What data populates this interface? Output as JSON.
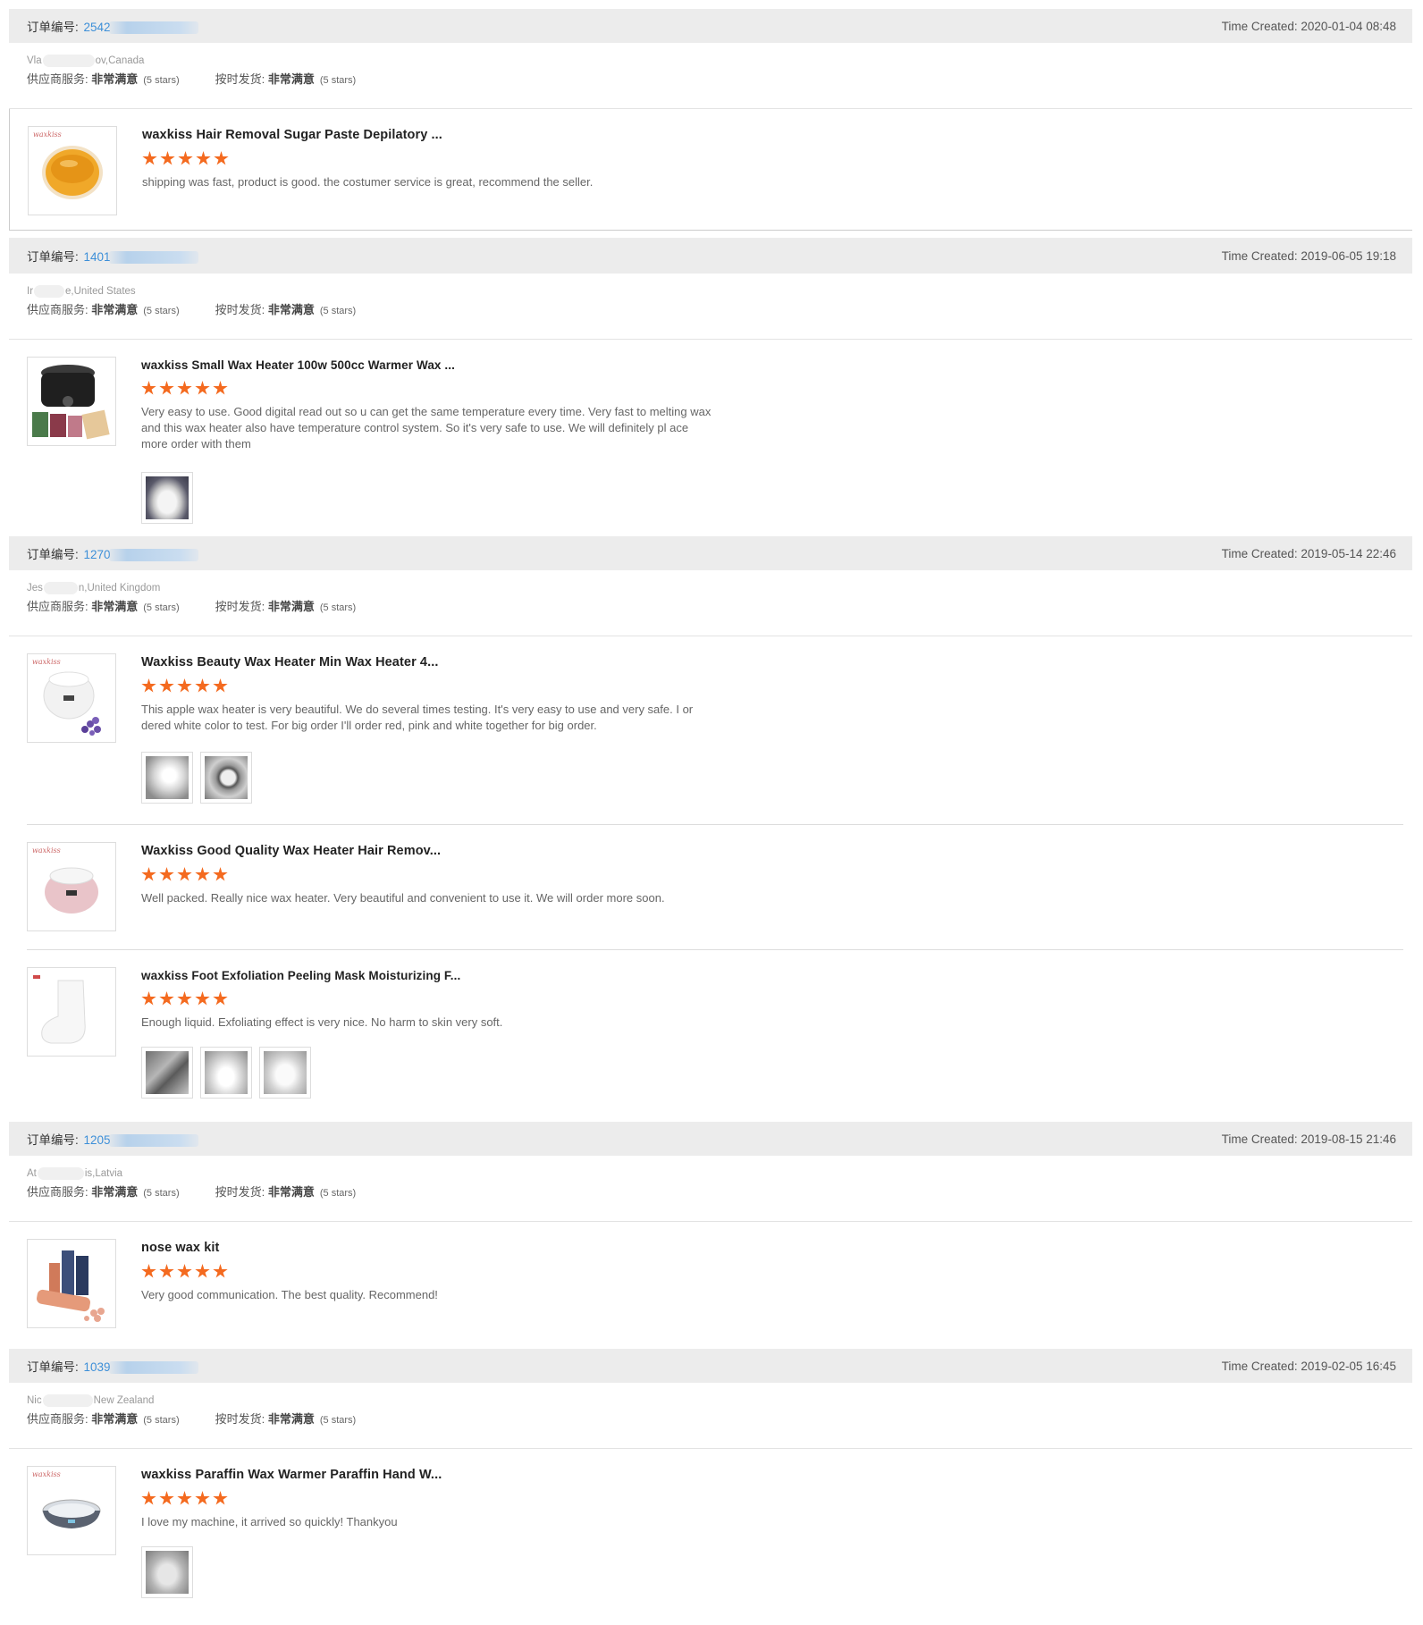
{
  "labels": {
    "order_no": "订单编号:",
    "time_created": "Time Created:",
    "supplier_service": "供应商服务:",
    "on_time_shipping": "按时发货:",
    "very_satisfied": "非常满意",
    "five_stars": "(5 stars)"
  },
  "orders": [
    {
      "order_no": "2542",
      "time": "2020-01-04 08:48",
      "buyer": {
        "start": "Vla",
        "end": "ov,Canada"
      },
      "products": [
        {
          "title": "waxkiss Hair Removal Sugar Paste Depilatory ...",
          "review": "shipping was fast, product is good. the costumer service is great, recommend the seller.",
          "thumb_icon": "sugar-paste-jar-icon",
          "photos": []
        }
      ]
    },
    {
      "order_no": "1401",
      "time": "2019-06-05 19:18",
      "buyer": {
        "start": "Ir",
        "end": "e,United States"
      },
      "products": [
        {
          "title": "waxkiss Small Wax Heater 100w 500cc Warmer Wax ...",
          "review": "Very easy to use. Good digital read out so u can get the same temperature every time. Very fast to melting wax and this wax heater also have temperature control system. So it's very safe to use. We will definitely pl ace more order with them",
          "thumb_icon": "black-wax-heater-icon",
          "photos": [
            "wax-heater-photo-icon"
          ]
        }
      ]
    },
    {
      "order_no": "1270",
      "time": "2019-05-14 22:46",
      "buyer": {
        "start": "Jes",
        "end": "n,United Kingdom"
      },
      "products": [
        {
          "title": "Waxkiss Beauty Wax Heater Min Wax Heater 4...",
          "review": "This apple wax heater is very beautiful.  We do several times testing. It's very easy to use and very safe. I or dered white color to test. For big order I'll order red, pink and white together for big order.",
          "thumb_icon": "white-wax-heater-icon",
          "photos": [
            "heater-side-photo-icon",
            "heater-top-photo-icon"
          ]
        },
        {
          "title": "Waxkiss Good Quality Wax Heater Hair Remov...",
          "review": "Well packed. Really nice wax heater. Very beautiful and convenient to use it. We will order more soon.",
          "thumb_icon": "pink-wax-heater-icon",
          "photos": []
        },
        {
          "title": "waxkiss Foot Exfoliation Peeling Mask Moisturizing F...",
          "review": "Enough liquid. Exfoliating effect is very nice. No harm to skin very soft.",
          "thumb_icon": "foot-mask-icon",
          "photos": [
            "mask-package-photo-icon",
            "mask-sock-photo-icon",
            "mask-pair-photo-icon"
          ]
        }
      ]
    },
    {
      "order_no": "1205",
      "time": "2019-08-15 21:46",
      "buyer": {
        "start": "At",
        "end": "is,Latvia"
      },
      "products": [
        {
          "title": "nose wax kit",
          "review": "Very good communication. The best quality. Recommend!",
          "thumb_icon": "nose-wax-kit-icon",
          "photos": []
        }
      ]
    },
    {
      "order_no": "1039",
      "time": "2019-02-05 16:45",
      "buyer": {
        "start": "Nic",
        "end": "New Zealand"
      },
      "products": [
        {
          "title": "waxkiss Paraffin Wax Warmer Paraffin Hand W...",
          "review": "I love my machine, it arrived so quickly! Thankyou",
          "thumb_icon": "paraffin-warmer-icon",
          "photos": [
            "paraffin-photo-icon"
          ]
        }
      ]
    }
  ],
  "colors": {
    "star": "#f46a1f",
    "order_link": "#3d8fd8",
    "header_bg": "#ececec"
  }
}
